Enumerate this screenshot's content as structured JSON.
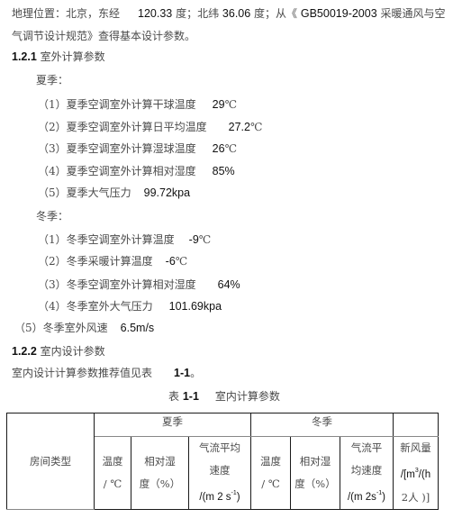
{
  "intro": {
    "line1_a": "地理位置：北京，东经",
    "longitude": "120.33",
    "line1_b": "度；北纬",
    "latitude": "36.06",
    "line1_c": "度；从《",
    "standard_code": "GB50019-2003",
    "line1_d": "采暖通风与空",
    "line2": "气调节设计规范》查得基本设计参数。"
  },
  "section_121": {
    "number": "1.2.1",
    "title": "室外计算参数"
  },
  "summer": {
    "heading": "夏季：",
    "items": [
      {
        "index": "（1）",
        "label": "夏季空调室外计算干球温度",
        "value": "29",
        "unit": "℃"
      },
      {
        "index": "（2）",
        "label": "夏季空调室外计算日平均温度",
        "value": "27.2",
        "unit": "℃"
      },
      {
        "index": "（3）",
        "label": "夏季空调室外计算湿球温度",
        "value": "26",
        "unit": "℃"
      },
      {
        "index": "（4）",
        "label": "夏季空调室外计算相对湿度",
        "value": "85%",
        "unit": ""
      },
      {
        "index": "（5）",
        "label": "夏季大气压力",
        "value": "99.72kpa",
        "unit": ""
      }
    ]
  },
  "winter": {
    "heading": "冬季：",
    "items": [
      {
        "index": "（1）",
        "label": "冬季空调室外计算温度",
        "value": "-9",
        "unit": "℃"
      },
      {
        "index": "（2）",
        "label": "冬季采暖计算温度",
        "value": "-6",
        "unit": "℃"
      },
      {
        "index": "（3）",
        "label": "冬季空调室外计算相对湿度",
        "value": "64%",
        "unit": ""
      },
      {
        "index": "（4）",
        "label": "冬季室外大气压力",
        "value": "101.69kpa",
        "unit": ""
      },
      {
        "index": "（5）",
        "label": "冬季室外风速",
        "value": "6.5m/s",
        "unit": ""
      }
    ]
  },
  "section_122": {
    "number": "1.2.2",
    "title": "室内设计参数"
  },
  "indoor_note": {
    "text": "室内设计计算参数推荐值见表",
    "ref": "1-1",
    "end": "。"
  },
  "table": {
    "caption_prefix": "表",
    "caption_number": "1-1",
    "caption_title": "室内计算参数",
    "room_type": "房间类型",
    "summer": "夏季",
    "winter": "冬季",
    "temp_label": "温度",
    "temp_unit": "/ ℃",
    "rh_label": "相对湿",
    "rh_unit": "度（%）",
    "airflow_summer_1": "气流平均",
    "airflow_summer_2": "速度",
    "airflow_summer_3": "/(m 2  s",
    "airflow_winter_1": "气流平",
    "airflow_winter_2": "均速度",
    "airflow_winter_3": "/(m 2s",
    "airflow_exp": "-1",
    "airflow_close": ")",
    "fresh_air_1": "新风量",
    "fresh_air_2a": "/[m",
    "fresh_air_exp": "3",
    "fresh_air_2b": "/(h",
    "fresh_air_3": "2人  )]"
  }
}
